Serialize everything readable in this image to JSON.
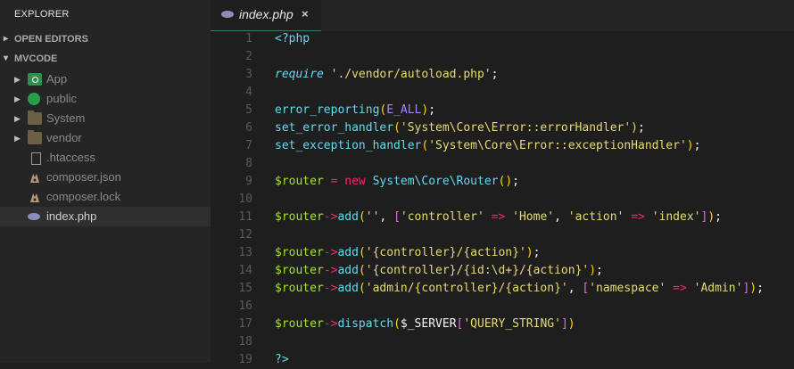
{
  "sidebar": {
    "title": "EXPLORER",
    "sections": [
      {
        "label": "OPEN EDITORS",
        "chevron": "▸"
      },
      {
        "label": "MVCODE",
        "chevron": "▾"
      }
    ],
    "items": [
      {
        "label": "App",
        "icon": "app-folder-icon",
        "kind": "folder"
      },
      {
        "label": "public",
        "icon": "public-folder-icon",
        "kind": "folder"
      },
      {
        "label": "System",
        "icon": "folder-icon",
        "kind": "folder"
      },
      {
        "label": "vendor",
        "icon": "folder-icon",
        "kind": "folder"
      },
      {
        "label": ".htaccess",
        "icon": "file-icon",
        "kind": "file"
      },
      {
        "label": "composer.json",
        "icon": "composer-icon",
        "kind": "file"
      },
      {
        "label": "composer.lock",
        "icon": "composer-icon",
        "kind": "file"
      },
      {
        "label": "index.php",
        "icon": "php-icon",
        "kind": "file",
        "active": true
      }
    ]
  },
  "tab": {
    "label": "index.php",
    "close": "×"
  },
  "editor": {
    "line_numbers": [
      "1",
      "2",
      "3",
      "4",
      "5",
      "6",
      "7",
      "8",
      "9",
      "10",
      "11",
      "12",
      "13",
      "14",
      "15",
      "16",
      "17",
      "18",
      "19"
    ],
    "lines": [
      "<?php",
      "",
      "require './vendor/autoload.php';",
      "",
      "error_reporting(E_ALL);",
      "set_error_handler('System\\Core\\Error::errorHandler');",
      "set_exception_handler('System\\Core\\Error::exceptionHandler');",
      "",
      "$router = new System\\Core\\Router();",
      "",
      "$router->add('', ['controller' => 'Home', 'action' => 'index']);",
      "",
      "$router->add('{controller}/{action}');",
      "$router->add('{controller}/{id:\\d+}/{action}');",
      "$router->add('admin/{controller}/{action}', ['namespace' => 'Admin']);",
      "",
      "$router->dispatch($_SERVER['QUERY_STRING'])",
      "",
      "?>"
    ]
  },
  "colors": {
    "background": "#1e1e1e",
    "sidebar": "#252526",
    "keyword": "#66d9ef",
    "string": "#e6db74",
    "function": "#a6e22e",
    "operator": "#f92672",
    "constant": "#ae81ff"
  }
}
